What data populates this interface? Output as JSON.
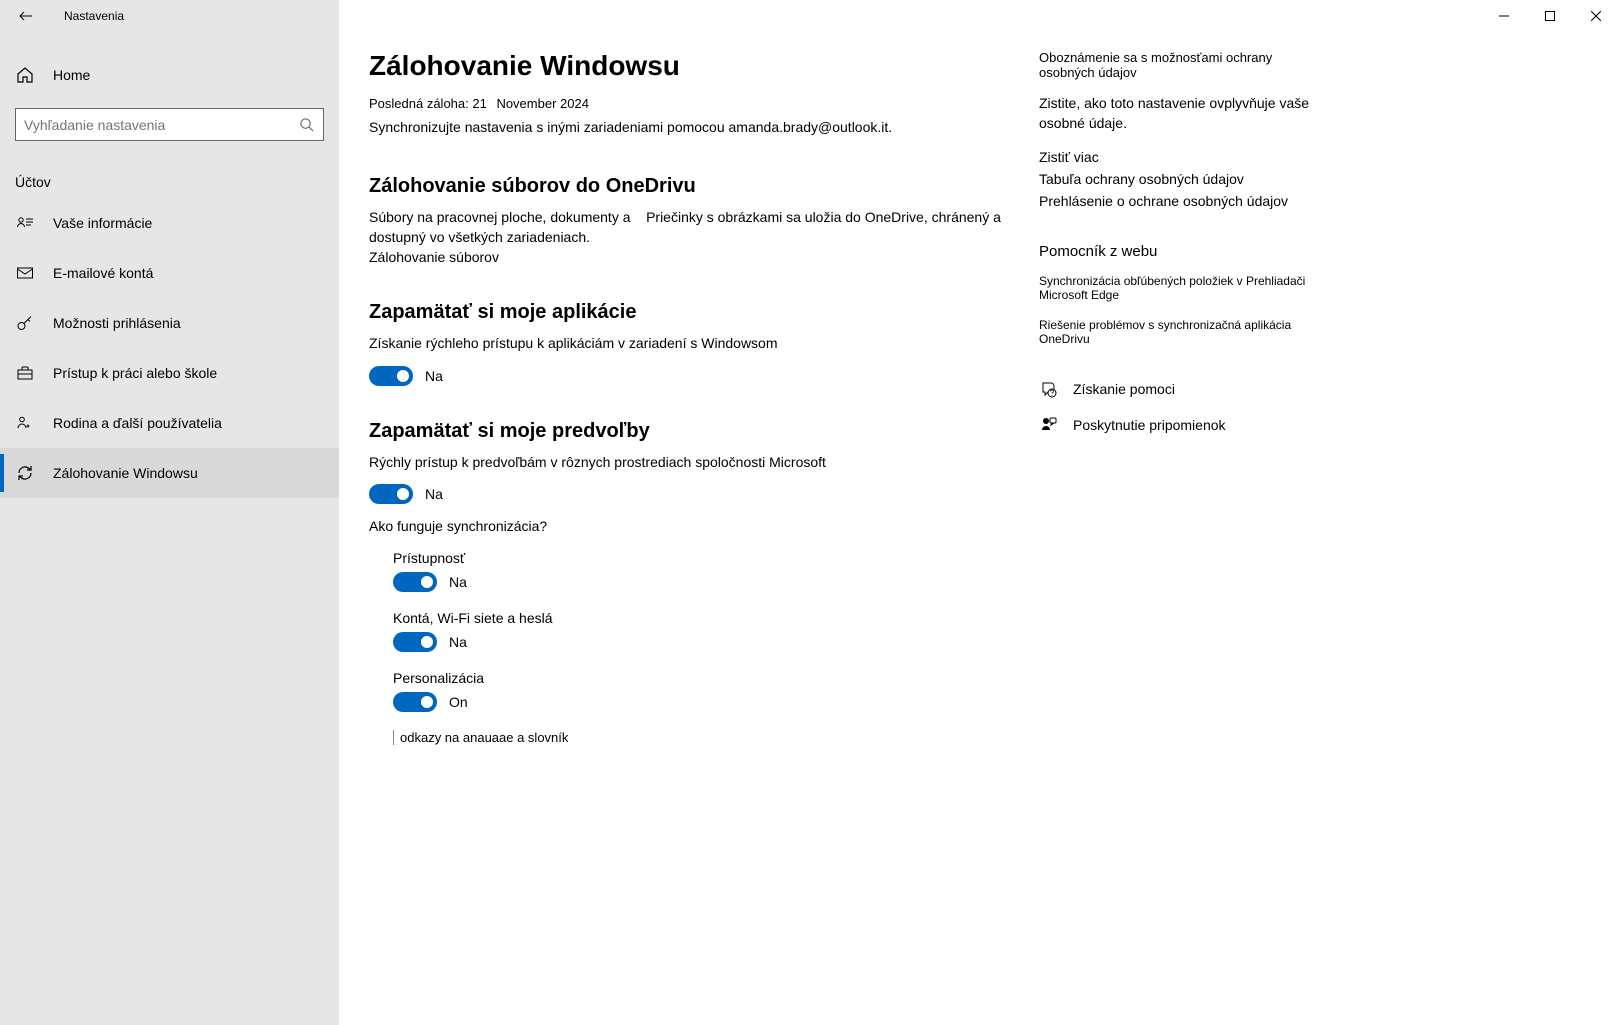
{
  "app_title": "Nastavenia",
  "home_label": "Home",
  "search_placeholder": "Vyhľadanie nastavenia",
  "section_label": "Účtov",
  "nav": [
    {
      "label": "Vaše informácie"
    },
    {
      "label": "E-mailové kontá"
    },
    {
      "label": "Možnosti prihlásenia"
    },
    {
      "label": "Prístup k práci alebo škole"
    },
    {
      "label": "Rodina a ďalší používatelia"
    },
    {
      "label": "Zálohovanie Windowsu"
    }
  ],
  "page": {
    "title": "Zálohovanie Windowsu",
    "last_backup_label": "Posledná záloha: 21",
    "last_backup_date": "November 2024",
    "sync_desc": "Synchronizujte nastavenia s inými zariadeniami pomocou amanda.brady@outlook.it.",
    "onedrive_title": "Zálohovanie súborov do OneDrivu",
    "onedrive_desc1": "Súbory na pracovnej ploche, dokumenty a",
    "onedrive_desc2": "Priečinky s obrázkami sa uložia do OneDrive, chránený a dostupný vo všetkých zariadeniach.",
    "onedrive_link": "Zálohovanie súborov",
    "apps_title": "Zapamätať si moje aplikácie",
    "apps_desc": "Získanie rýchleho prístupu k aplikáciám v zariadení s Windowsom",
    "apps_toggle_state": "Na",
    "prefs_title": "Zapamätať si moje predvoľby",
    "prefs_desc": "Rýchly prístup k predvoľbám v rôznych prostrediach spoločnosti Microsoft",
    "prefs_toggle_state": "Na",
    "how_sync": "Ako funguje synchronizácia?",
    "sub_prefs": [
      {
        "label": "Prístupnosť",
        "state": "Na"
      },
      {
        "label": "Kontá, Wi-Fi siete a heslá",
        "state": "Na"
      },
      {
        "label": "Personalizácia",
        "state": "On"
      }
    ],
    "lang_dict": "odkazy na anauaae a slovník"
  },
  "right": {
    "privacy_title": "Oboznámenie sa s možnosťami ochrany osobných údajov",
    "privacy_desc": "Zistite, ako toto nastavenie ovplyvňuje vaše osobné údaje.",
    "privacy_links": [
      "Zistiť viac",
      "Tabuľa ochrany osobných údajov",
      "Prehlásenie o ochrane osobných údajov"
    ],
    "web_help_title": "Pomocník z webu",
    "web_help_links": [
      "Synchronizácia obľúbených položiek v Prehliadači Microsoft Edge",
      "Riešenie problémov s synchronizačná aplikácia OneDrivu"
    ],
    "get_help": "Získanie pomoci",
    "feedback": "Poskytnutie pripomienok"
  }
}
